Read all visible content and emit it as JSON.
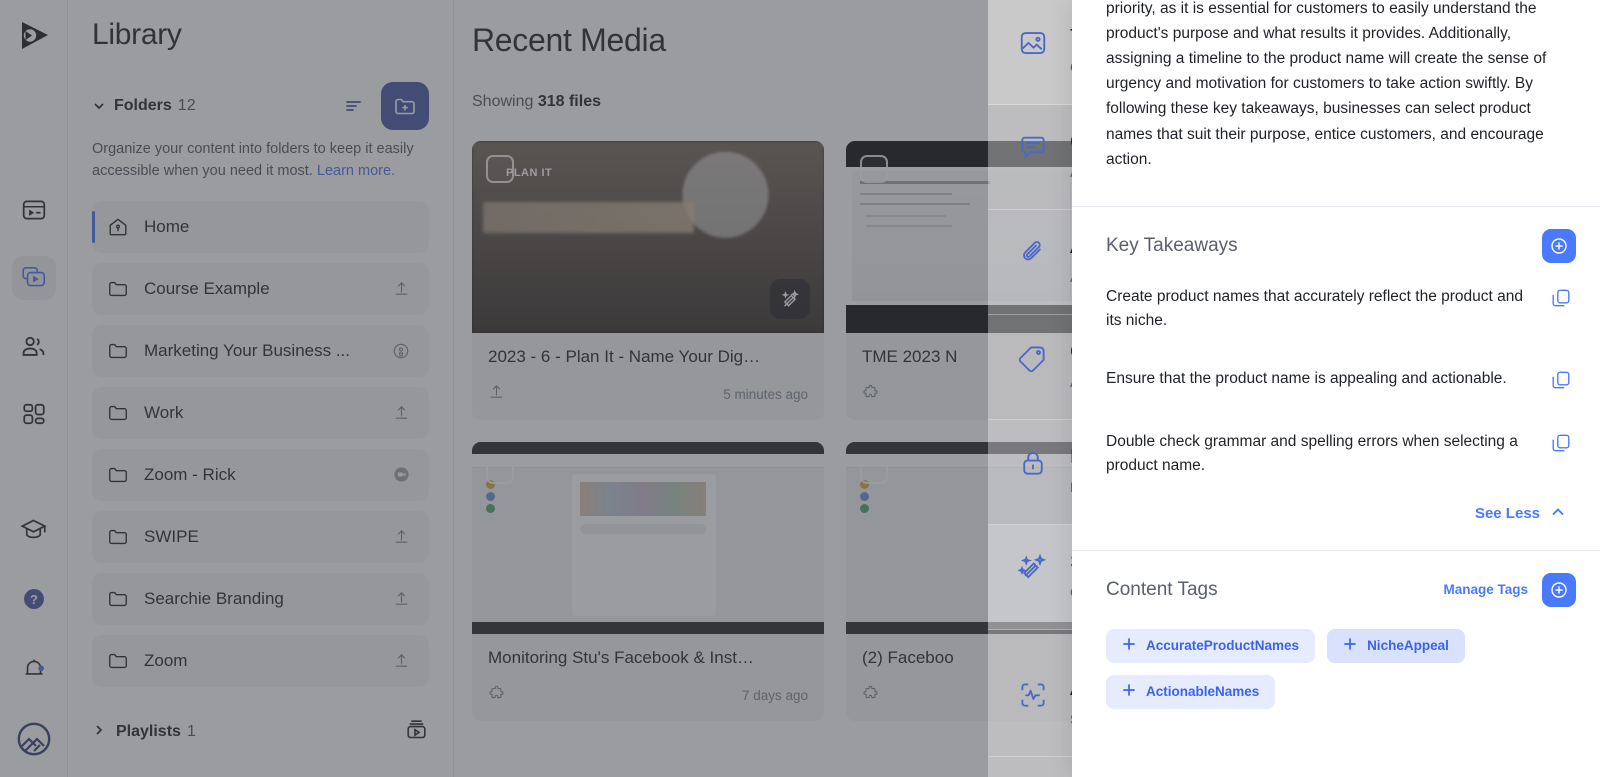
{
  "rail": {
    "logo_icon": "searchie-logo-icon",
    "items": [
      {
        "icon": "media-player-icon",
        "name": "rail-item-player",
        "active": false
      },
      {
        "icon": "video-library-icon",
        "name": "rail-item-library",
        "active": true
      },
      {
        "icon": "people-icon",
        "name": "rail-item-audience",
        "active": false
      },
      {
        "icon": "apps-grid-icon",
        "name": "rail-item-apps",
        "active": false
      }
    ],
    "bottom_items": [
      {
        "icon": "graduation-cap-icon",
        "name": "rail-item-training"
      },
      {
        "icon": "help-question-icon",
        "name": "rail-item-help"
      },
      {
        "icon": "bell-notification-icon",
        "name": "rail-item-notifications"
      },
      {
        "icon": "account-avatar-icon",
        "name": "rail-item-account"
      }
    ]
  },
  "sidebar": {
    "title": "Library",
    "folders_label": "Folders",
    "folders_count": "12",
    "sort_icon": "sort-icon",
    "add_folder_icon": "folder-plus-icon",
    "blurb_text": "Organize your content into folders to keep it easily accessible when you need it most. ",
    "blurb_link": "Learn more.",
    "folders": [
      {
        "label": "Home",
        "icon": "home-icon",
        "right_icon": "none",
        "active": true
      },
      {
        "label": "Course Example",
        "icon": "folder-icon",
        "right_icon": "upload-icon",
        "active": false
      },
      {
        "label": "Marketing Your Business ...",
        "icon": "folder-icon",
        "right_icon": "podcast-icon",
        "active": false
      },
      {
        "label": "Work",
        "icon": "folder-icon",
        "right_icon": "upload-icon",
        "active": false
      },
      {
        "label": "Zoom - Rick",
        "icon": "folder-icon",
        "right_icon": "video-badge-icon",
        "active": false
      },
      {
        "label": "SWIPE",
        "icon": "folder-icon",
        "right_icon": "upload-icon",
        "active": false
      },
      {
        "label": "Searchie Branding",
        "icon": "folder-icon",
        "right_icon": "upload-icon",
        "active": false
      },
      {
        "label": "Zoom",
        "icon": "folder-icon",
        "right_icon": "upload-icon",
        "active": false
      }
    ],
    "playlists_label": "Playlists",
    "playlists_count": "1",
    "playlists_icon": "playlist-icon"
  },
  "main": {
    "title": "Recent Media",
    "showing_prefix": "Showing ",
    "showing_count": "318 files",
    "cards": [
      {
        "title": "2023 - 6 - Plan It - Name Your Dig…",
        "time": "5 minutes ago",
        "badge": "PLAN IT",
        "left_icon": "upload-icon",
        "has_magic": true,
        "thumb": "office"
      },
      {
        "title": "TME 2023 N",
        "time": "",
        "badge": "",
        "left_icon": "puzzle-icon",
        "has_magic": false,
        "thumb": "doc"
      },
      {
        "title": "Monitoring Stu's Facebook & Inst…",
        "time": "7 days ago",
        "badge": "",
        "left_icon": "puzzle-icon",
        "has_magic": false,
        "thumb": "fb"
      },
      {
        "title": "(2) Faceboo",
        "time": "",
        "badge": "",
        "left_icon": "puzzle-icon",
        "has_magic": false,
        "thumb": "fb"
      }
    ]
  },
  "drawer": {
    "items": [
      {
        "icon": "image-icon",
        "title": "T",
        "desc": "C",
        "selected": true
      },
      {
        "icon": "caption-icon",
        "title": "C",
        "desc": "A",
        "selected": false
      },
      {
        "icon": "paperclip-icon",
        "title": "A",
        "desc": "A",
        "selected": false
      },
      {
        "icon": "tag-icon",
        "title": "C",
        "desc": "A",
        "selected": false
      },
      {
        "icon": "lock-icon",
        "title": "P",
        "desc": "M",
        "selected": false
      },
      {
        "icon": "magic-wand-icon",
        "title": "S",
        "desc": "G",
        "selected": true
      },
      {
        "icon": "analytics-icon",
        "title": "A",
        "desc": "S",
        "selected": false
      }
    ]
  },
  "panel": {
    "summary_paragraph": "priority, as it is essential for customers to easily understand the product's purpose and what results it provides. Additionally, assigning a timeline to the product name will create the sense of urgency and motivation for customers to take action swiftly. By following these key takeaways, businesses can select product names that suit their purpose, entice customers, and encourage action.",
    "takeaways_section": {
      "title": "Key Takeaways",
      "add_icon": "circle-plus-icon",
      "items": [
        {
          "text": "Create product names that accurately reflect the product and its niche.",
          "copy_icon": "copy-icon"
        },
        {
          "text": "Ensure that the product name is appealing and actionable.",
          "copy_icon": "copy-icon"
        },
        {
          "text": "Double check grammar and spelling errors when selecting a product name.",
          "copy_icon": "copy-icon"
        }
      ],
      "see_less_label": "See Less",
      "see_less_icon": "chevron-up-icon"
    },
    "tags_section": {
      "title": "Content Tags",
      "manage_label": "Manage Tags",
      "add_icon": "circle-plus-icon",
      "tags": [
        {
          "label": "AccurateProductNames",
          "icon": "plus-icon",
          "style": "light"
        },
        {
          "label": "NicheAppeal",
          "icon": "plus-icon",
          "style": "dark"
        },
        {
          "label": "ActionableNames",
          "icon": "plus-icon",
          "style": "light"
        }
      ]
    }
  },
  "colors": {
    "accent_blue": "#4a7afc",
    "deep_blue": "#3b4fa0",
    "link_blue": "#3f6ef2",
    "tag_bg": "#e6ecfe",
    "tag_bg_alt": "#d9e2fd"
  }
}
